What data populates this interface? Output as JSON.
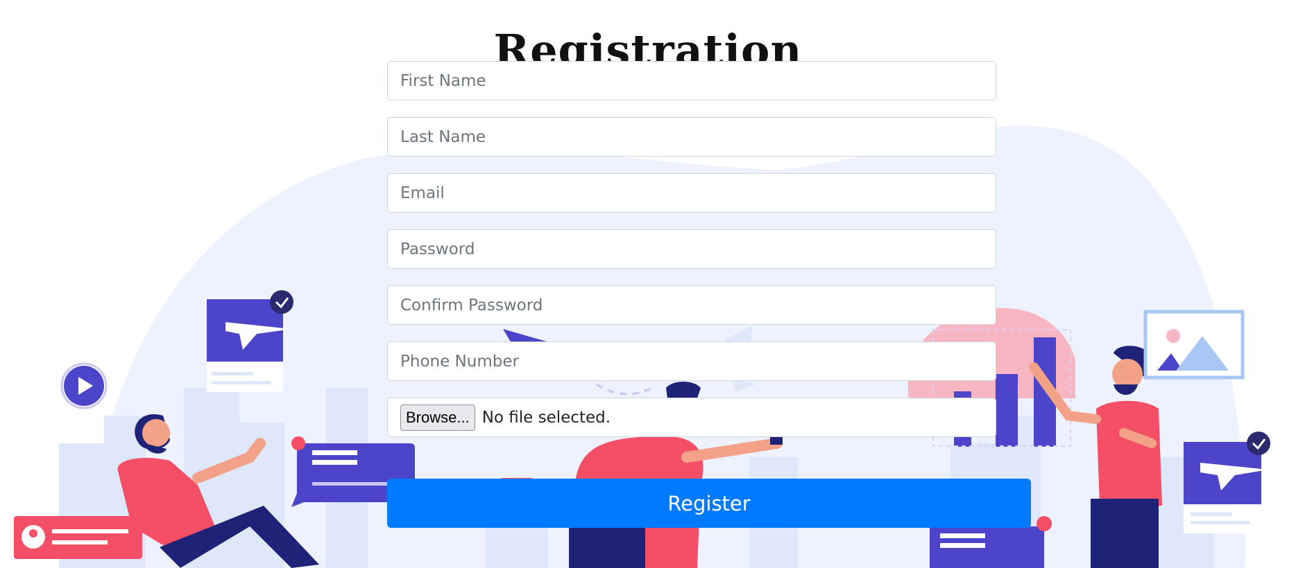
{
  "page": {
    "title": "Registration"
  },
  "form": {
    "first_name": {
      "placeholder": "First Name",
      "value": ""
    },
    "last_name": {
      "placeholder": "Last Name",
      "value": ""
    },
    "email": {
      "placeholder": "Email",
      "value": ""
    },
    "password": {
      "placeholder": "Password",
      "value": ""
    },
    "confirm_password": {
      "placeholder": "Confirm Password",
      "value": ""
    },
    "phone": {
      "placeholder": "Phone Number",
      "value": ""
    },
    "file": {
      "button_label": "Browse...",
      "status": "No file selected."
    },
    "submit_label": "Register"
  },
  "colors": {
    "primary_button": "#007bff",
    "background_blob": "#eef2fe",
    "illustration_purple": "#4c45c9",
    "illustration_red": "#f44f66",
    "illustration_navy": "#1f2377",
    "illustration_light_blue": "#dbe6fb"
  },
  "illustration": {
    "icons": [
      "play-icon",
      "plane-card-icon",
      "check-badge-icon",
      "chat-bubble-icon",
      "user-card-icon",
      "bar-chart-icon",
      "image-frame-icon",
      "paper-plane-icon"
    ]
  }
}
